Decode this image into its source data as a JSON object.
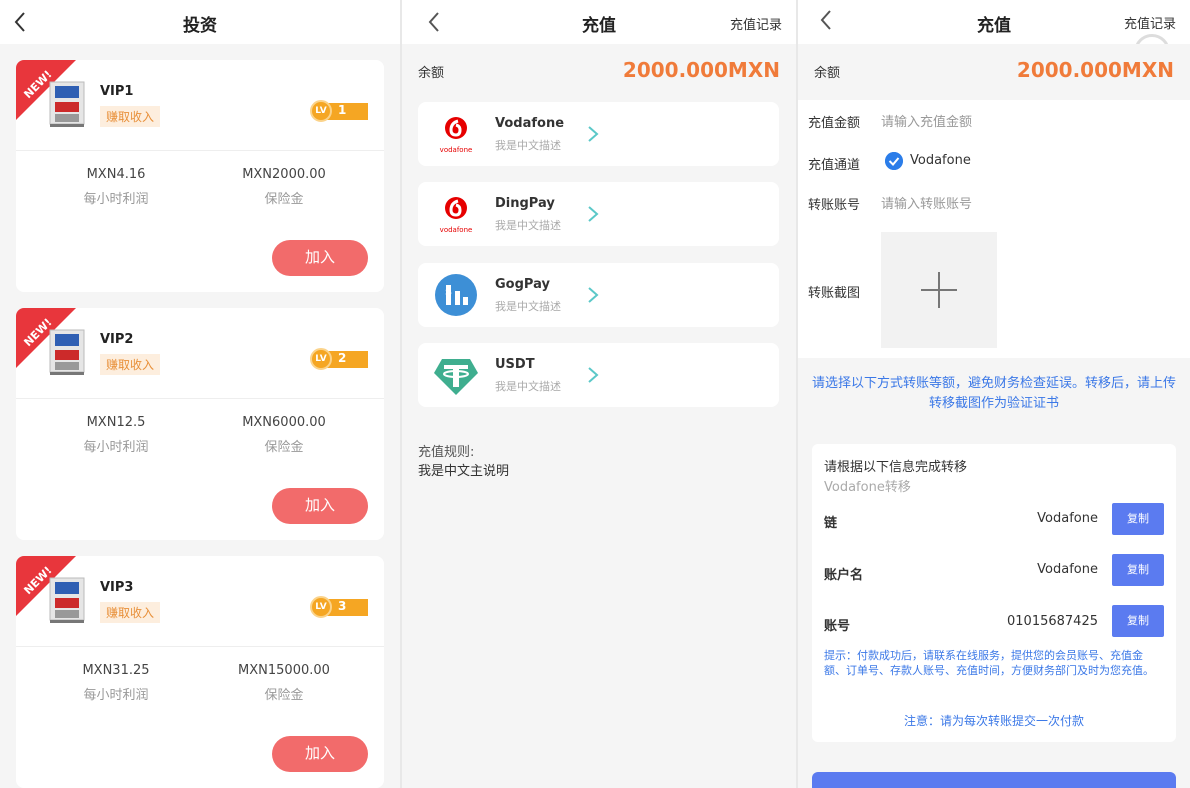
{
  "invest": {
    "title": "投资",
    "ribbon_text": "NEW!",
    "hourly_label": "每小时利润",
    "deposit_label": "保险金",
    "earn_label": "赚取收入",
    "join_label": "加入",
    "level_prefix": "LV",
    "plans": [
      {
        "name": "VIP1",
        "level": "1",
        "hourly_profit": "MXN4.16",
        "deposit": "MXN2000.00"
      },
      {
        "name": "VIP2",
        "level": "2",
        "hourly_profit": "MXN12.5",
        "deposit": "MXN6000.00"
      },
      {
        "name": "VIP3",
        "level": "3",
        "hourly_profit": "MXN31.25",
        "deposit": "MXN15000.00"
      }
    ]
  },
  "recharge": {
    "title": "充值",
    "record_link": "充值记录",
    "balance_label": "余额",
    "balance_value": "2000.000MXN",
    "channels": [
      {
        "name": "Vodafone",
        "desc": "我是中文描述",
        "icon": "vodafone-logo"
      },
      {
        "name": "DingPay",
        "desc": "我是中文描述",
        "icon": "vodafone-logo"
      },
      {
        "name": "GogPay",
        "desc": "我是中文描述",
        "icon": "dollar-chart-logo"
      },
      {
        "name": "USDT",
        "desc": "我是中文描述",
        "icon": "tether-logo"
      }
    ],
    "rules_label": "充值规则:",
    "rules_text": "我是中文主说明",
    "vodafone_small": "vodafone"
  },
  "transfer": {
    "title": "充值",
    "record_link": "充值记录",
    "balance_label": "余额",
    "balance_value": "2000.000MXN",
    "amount_label": "充值金额",
    "amount_placeholder": "请输入充值金额",
    "channel_label": "充值通道",
    "channel_value": "Vodafone",
    "account_label": "转账账号",
    "account_placeholder": "请输入转账账号",
    "screenshot_label": "转账截图",
    "notice": "请选择以下方式转账等额，避免财务检查延误。转移后，请上传转移截图作为验证证书",
    "box_title": "请根据以下信息完成转移",
    "box_subtitle": "Vodafone转移",
    "fields": [
      {
        "label": "链",
        "value": "Vodafone"
      },
      {
        "label": "账户名",
        "value": "Vodafone"
      },
      {
        "label": "账号",
        "value": "01015687425"
      }
    ],
    "copy_label": "复制",
    "tip": "提示：付款成功后，请联系在线服务，提供您的会员账号、充值金额、订单号、存款人账号、充值时间，方便财务部门及时为您充值。",
    "warning": "注意：请为每次转账提交一次付款"
  },
  "colors": {
    "accent_orange": "#f07b3a",
    "join_red": "#f26b6b",
    "primary_blue": "#5b7bf0",
    "link_blue": "#3b78e7",
    "level_gold": "#f5a623",
    "ribbon_red": "#e8363c"
  }
}
